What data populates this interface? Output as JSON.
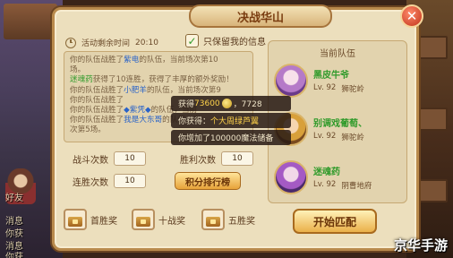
{
  "title": "决战华山",
  "close_label": "✕",
  "timer": {
    "label": "活动剩余时间",
    "value": "20:10"
  },
  "keep_info": {
    "label": "只保留我的信息",
    "checked_mark": "✓"
  },
  "log_lines": [
    {
      "pre": "你的队伍战胜了",
      "hl": "紫电",
      "post": "的队伍，当前场次第10"
    },
    {
      "pre": "场。",
      "hl": "",
      "post": ""
    },
    {
      "pre": "",
      "hl2": "迷魂药",
      "post": "获得了10连胜，获得了丰厚的额外奖励！"
    },
    {
      "pre": "你的队伍战胜了",
      "hl": "小肥羊",
      "post": "的队伍，当前场次第9"
    },
    {
      "pre": "",
      "hl": "",
      "post": "你的队伍战胜了"
    },
    {
      "pre": "你的队伍战胜了",
      "hl": "◆紫凭◆",
      "post": "的队伍，当前"
    },
    {
      "pre": "你的队伍战胜了",
      "hl": "我是大东哥",
      "post": "的队伍，当"
    },
    {
      "pre": "次第5场。",
      "hl": "",
      "post": ""
    }
  ],
  "stats": {
    "battles_label": "战斗次数",
    "battles_value": "10",
    "wins_label": "胜利次数",
    "wins_value": "10",
    "streak_label": "连胜次数",
    "streak_value": "10"
  },
  "rank_button": "积分排行榜",
  "rewards": [
    {
      "label": "首胜奖"
    },
    {
      "label": "十战奖"
    },
    {
      "label": "五胜奖"
    }
  ],
  "team": {
    "title": "当前队伍",
    "members": [
      {
        "name": "黑皮牛爷",
        "level": "Lv. 92",
        "school": "狮驼岭"
      },
      {
        "name": "别调戏葡萄、",
        "level": "Lv. 92",
        "school": "狮驼岭"
      },
      {
        "name": "迷魂药",
        "level": "Lv. 92",
        "school": "阴曹地府"
      }
    ]
  },
  "match_button": "开始匹配",
  "toasts": [
    {
      "pre": "获得",
      "amount": "73600",
      "post": "，7728"
    },
    {
      "pre": "你获得：",
      "amount": "个大周绿芦翼",
      "post": ""
    },
    {
      "pre": "你增加了100000魔法储备",
      "amount": "",
      "post": ""
    }
  ],
  "side_text": [
    "好友",
    "消息",
    "你获",
    "消息",
    "你获"
  ],
  "watermark": "京华手游"
}
